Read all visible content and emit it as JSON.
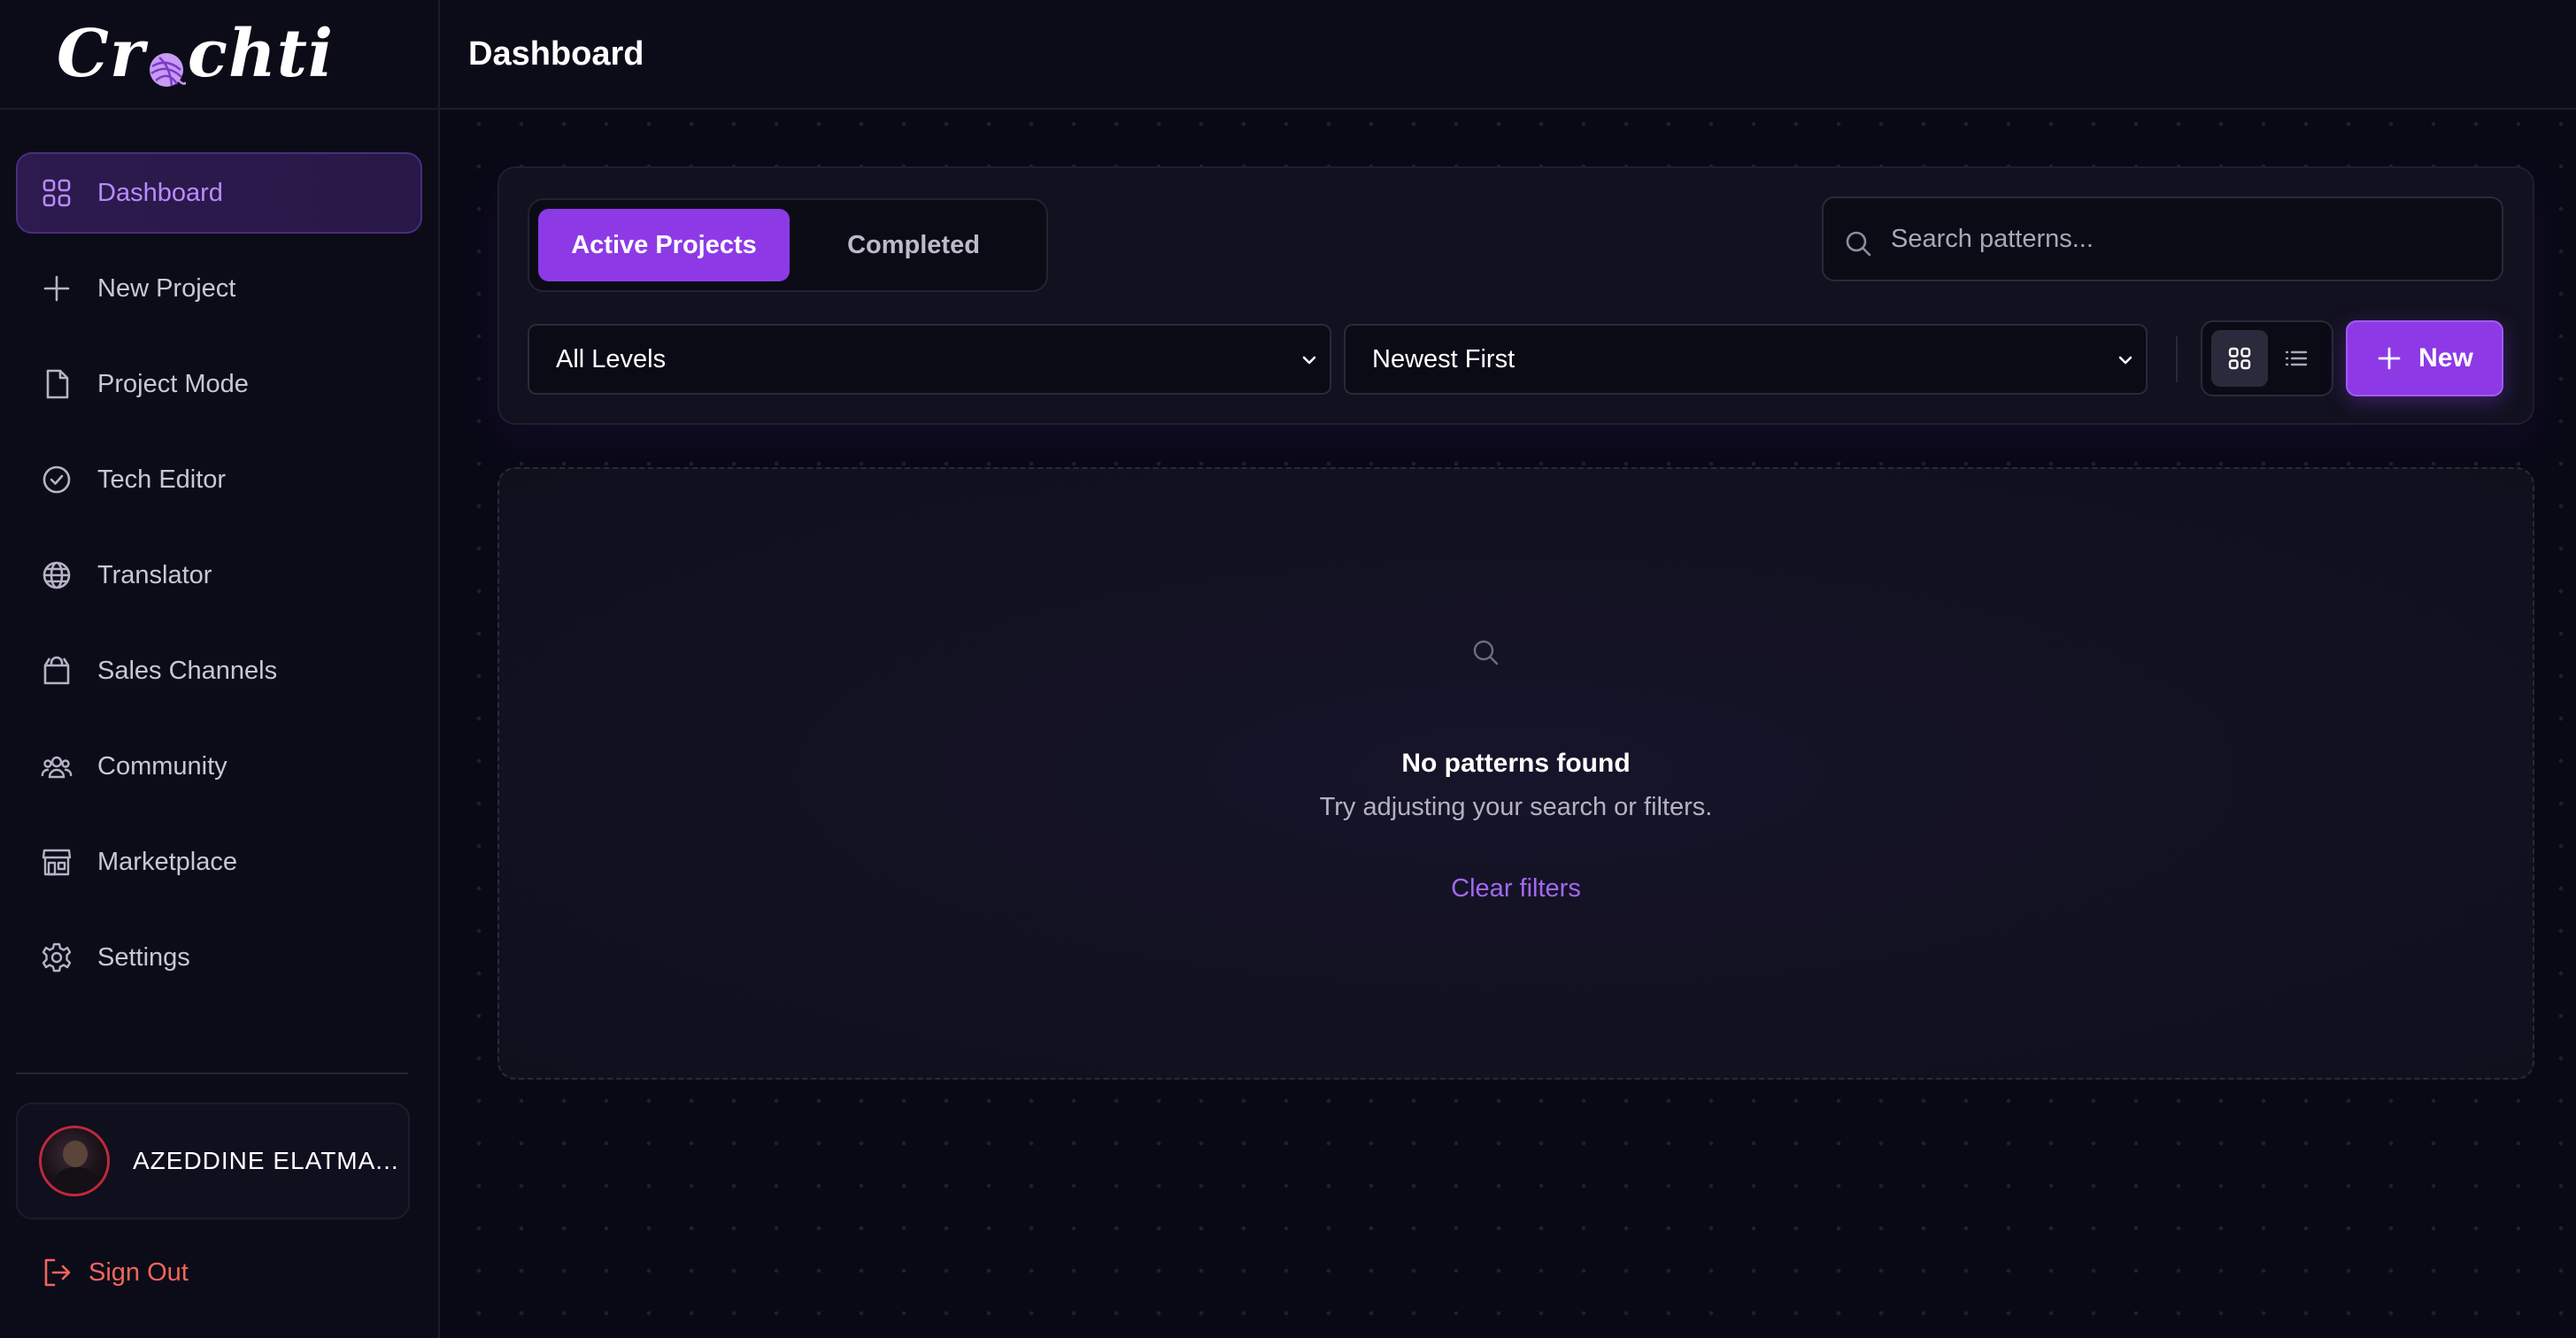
{
  "app": {
    "logo_text_left": "Cr",
    "logo_text_right": "chti",
    "accent_color": "#8d3ae6"
  },
  "header": {
    "title": "Dashboard"
  },
  "sidebar": {
    "items": [
      {
        "label": "Dashboard",
        "icon": "grid-icon",
        "active": true
      },
      {
        "label": "New Project",
        "icon": "plus-icon",
        "active": false
      },
      {
        "label": "Project Mode",
        "icon": "file-icon",
        "active": false
      },
      {
        "label": "Tech Editor",
        "icon": "check-circle-icon",
        "active": false
      },
      {
        "label": "Translator",
        "icon": "globe-icon",
        "active": false
      },
      {
        "label": "Sales Channels",
        "icon": "shopping-bag-icon",
        "active": false
      },
      {
        "label": "Community",
        "icon": "users-icon",
        "active": false
      },
      {
        "label": "Marketplace",
        "icon": "store-icon",
        "active": false
      },
      {
        "label": "Settings",
        "icon": "gear-icon",
        "active": false
      }
    ],
    "user": {
      "name": "AZEDDINE ELATMA..."
    },
    "sign_out": {
      "label": "Sign Out",
      "color": "#f2665a"
    }
  },
  "toolbar": {
    "tabs": [
      {
        "label": "Active Projects",
        "active": true
      },
      {
        "label": "Completed",
        "active": false
      }
    ],
    "search": {
      "placeholder": "Search patterns...",
      "value": ""
    },
    "level_filter": {
      "selected": "All Levels"
    },
    "sort": {
      "selected": "Newest First"
    },
    "view_mode": "grid",
    "new_label": "New"
  },
  "empty_state": {
    "title": "No patterns found",
    "subtitle": "Try adjusting your search or filters.",
    "action": "Clear filters"
  }
}
